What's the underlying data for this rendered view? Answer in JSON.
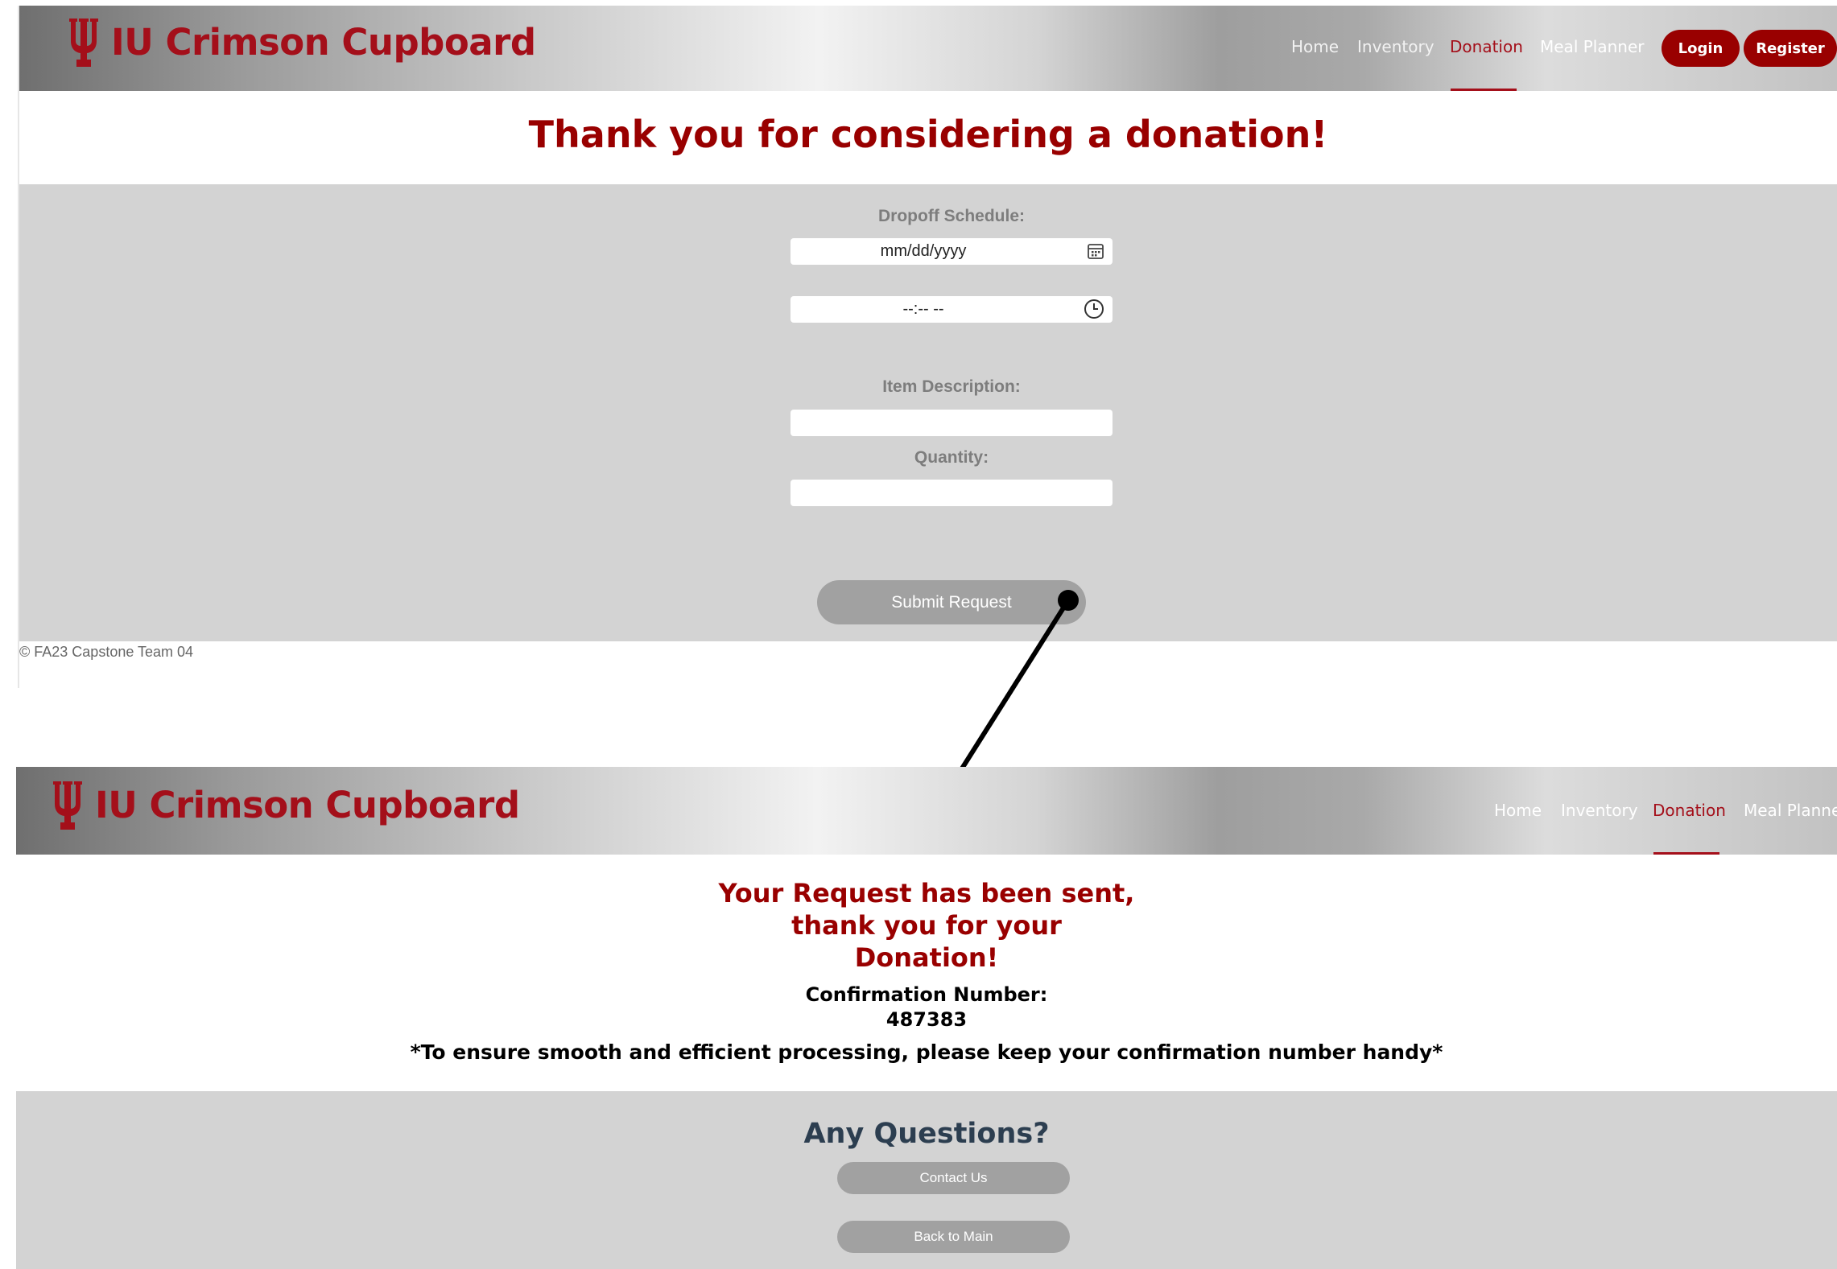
{
  "brand": {
    "name": "IU Crimson Cupboard",
    "logo_icon": "trident-icon",
    "color": "#a40f1a"
  },
  "nav1": {
    "links": [
      "Home",
      "Inventory",
      "Donation",
      "Meal Planner"
    ],
    "active": "Donation",
    "login": "Login",
    "register": "Register"
  },
  "form_page": {
    "heading": "Thank you for considering a donation!",
    "dropoff_label": "Dropoff Schedule:",
    "date_placeholder": "mm/dd/yyyy",
    "date_icon": "calendar-icon",
    "time_placeholder": "--:-- --",
    "time_icon": "clock-icon",
    "item_label": "Item Description:",
    "item_value": "",
    "quantity_label": "Quantity:",
    "quantity_value": "",
    "submit": "Submit Request",
    "copyright": "© FA23 Capstone Team 04"
  },
  "nav2": {
    "links": [
      "Home",
      "Inventory",
      "Donation",
      "Meal Planner"
    ],
    "active": "Donation"
  },
  "confirmation_page": {
    "title_lines": [
      "Your Request has been sent,",
      "thank you for your",
      "Donation!"
    ],
    "confirmation_label": "Confirmation Number:",
    "confirmation_number": "487383",
    "note": "*To ensure smooth and efficient processing, please keep your confirmation number handy*",
    "questions_title": "Any Questions?",
    "contact_button": "Contact Us",
    "back_button": "Back to Main"
  },
  "colors": {
    "crimson": "#990000",
    "panel_gray": "#d3d3d3",
    "button_gray": "#a1a1a1",
    "heading_navy": "#2c3e50"
  }
}
